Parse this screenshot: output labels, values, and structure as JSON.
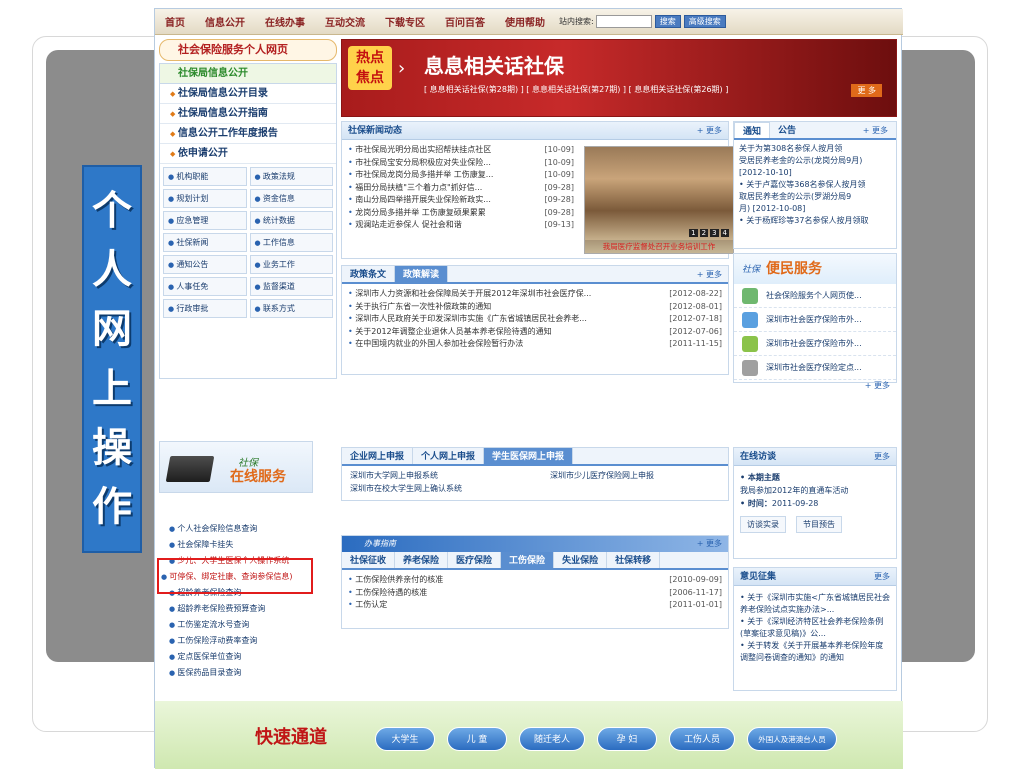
{
  "banner": {
    "chars": [
      "个",
      "人",
      "网",
      "上",
      "操",
      "作"
    ]
  },
  "topnav": {
    "items": [
      "首页",
      "信息公开",
      "在线办事",
      "互动交流",
      "下载专区",
      "百问百答",
      "使用帮助"
    ],
    "search_label": "站内搜索:",
    "search_btn": "搜索",
    "advanced_btn": "高级搜索"
  },
  "left": {
    "portal_title": "社会保险服务个人网页",
    "info_head": "社保局信息公开",
    "main_items": [
      "社保局信息公开目录",
      "社保局信息公开指南",
      "信息公开工作年度报告",
      "依申请公开"
    ],
    "grid": [
      "机构职能",
      "政策法规",
      "规划计划",
      "资金信息",
      "应急管理",
      "统计数据",
      "社保新闻",
      "工作信息",
      "通知公告",
      "业务工作",
      "人事任免",
      "监督渠道",
      "行政审批",
      "联系方式"
    ]
  },
  "hot": {
    "badge1": "热点",
    "badge2": "焦点",
    "title": "息息相关话社保",
    "sub": "[ 息息相关话社保(第28期) ] [ 息息相关话社保(第27期) ] [ 息息相关话社保(第26期) ]",
    "more": "更 多"
  },
  "news": {
    "title": "社保新闻动态",
    "more": "+ 更多",
    "items": [
      {
        "t": "市社保局光明分局出实招帮扶挂点社区",
        "d": "[10-09]"
      },
      {
        "t": "市社保局宝安分局积极应对失业保险...",
        "d": "[10-09]"
      },
      {
        "t": "市社保局龙岗分局多措并举 工伤康复...",
        "d": "[10-09]"
      },
      {
        "t": "福田分局扶植\"三个着力点\"抓好信...",
        "d": "[09-28]"
      },
      {
        "t": "南山分局四举措开展失业保险新政实...",
        "d": "[09-28]"
      },
      {
        "t": "龙岗分局多措并举 工伤康复硕果累累",
        "d": "[09-28]"
      },
      {
        "t": "观澜站走近参保人 促社会和谐",
        "d": "[09-13]"
      }
    ],
    "photo_caption": "我局医疗监督处召开业务培训工作",
    "photo_pages": [
      "1",
      "2",
      "3",
      "4"
    ]
  },
  "notice": {
    "tab1": "通知",
    "tab2": "公告",
    "more": "+ 更多",
    "lines": [
      "关于为第308名参保人按月领",
      "受居民养老金的公示(龙岗分局9月)",
      "[2012-10-10]",
      "• 关于卢嘉仪等368名参保人按月领",
      "取居民养老金的公示(罗湖分局9",
      "月) [2012-10-08]",
      "• 关于杨辉珍等37名参保人按月领取"
    ]
  },
  "policy": {
    "tab1": "政策条文",
    "tab2": "政策解读",
    "more": "+ 更多",
    "items": [
      {
        "t": "深圳市人力资源和社会保障局关于开展2012年深圳市社会医疗保...",
        "d": "[2012-08-22]"
      },
      {
        "t": "关于执行广东省一次性补偿政策的通知",
        "d": "[2012-08-01]"
      },
      {
        "t": "深圳市人民政府关于印发深圳市实施《广东省城镇居民社会养老...",
        "d": "[2012-07-18]"
      },
      {
        "t": "关于2012年调整企业退休人员基本养老保险待遇的通知",
        "d": "[2012-07-06]"
      },
      {
        "t": "在中国境内就业的外国人参加社会保险暂行办法",
        "d": "[2011-11-15]"
      }
    ]
  },
  "service": {
    "label1": "社保",
    "label2": "便民服务",
    "items": [
      "社会保险服务个人网页使...",
      "深圳市社会医疗保险市外...",
      "深圳市社会医疗保险市外...",
      "深圳市社会医疗保险定点..."
    ],
    "more": "+ 更多"
  },
  "online": {
    "label1": "社保",
    "label2": "在线服务",
    "items": [
      "个人社会保险信息查询",
      "社会保障卡挂失",
      "少儿、大学生医保个人操作系统",
      "可停保、绑定社康、查询参保信息)",
      "超龄养老保险查询",
      "超龄养老保险费预算查询",
      "工伤鉴定流水号查询",
      "工伤保险浮动费率查询",
      "定点医保单位查询",
      "医保药品目录查询"
    ]
  },
  "declare": {
    "tabs": [
      "企业网上申报",
      "个人网上申报",
      "学生医保网上申报"
    ],
    "links": [
      "深圳市大学网上申报系统",
      "深圳市少儿医疗保险网上申报",
      "深圳市在校大学生网上确认系统"
    ]
  },
  "guide": {
    "label": "办事指南",
    "more": "+ 更多",
    "tabs": [
      "社保征收",
      "养老保险",
      "医疗保险",
      "工伤保险",
      "失业保险",
      "社保转移"
    ],
    "items": [
      {
        "t": "工伤保险供养亲付的核准",
        "d": "[2010-09-09]"
      },
      {
        "t": "工伤保险待遇的核准",
        "d": "[2006-11-17]"
      },
      {
        "t": "工伤认定",
        "d": "[2011-01-01]"
      }
    ]
  },
  "visit": {
    "title": "在线访谈",
    "more": "更多",
    "topic_label": "• 本期主题",
    "topic": "我局参加2012年的直通车活动",
    "time_label": "• 时间：",
    "time": "2011-09-28",
    "btn1": "访谈实录",
    "btn2": "节目预告"
  },
  "opinion": {
    "title": "意见征集",
    "more": "更多",
    "items": [
      "• 关于《深圳市实施<广东省城镇居民社会养老保险试点实施办法>...",
      "• 关于《深圳经济特区社会养老保险条例(草案征求意见稿)》公...",
      "• 关于转发《关于开展基本养老保险年度调整问卷调查的通知》的通知"
    ]
  },
  "quick": {
    "title": "快速通道",
    "pills": [
      "大学生",
      "儿 童",
      "随迁老人",
      "孕 妇",
      "工伤人员",
      "外国人及港澳台人员"
    ]
  }
}
